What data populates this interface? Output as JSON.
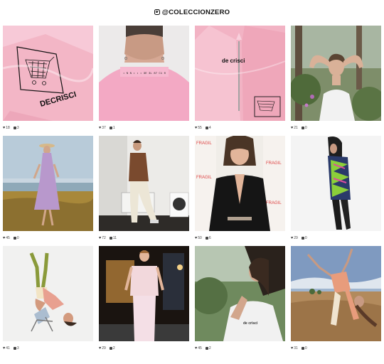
{
  "header": {
    "handle": "@COLECCIONZERO",
    "icon": "instagram-icon"
  },
  "posts": [
    {
      "likes": "18",
      "comments": "3"
    },
    {
      "likes": "37",
      "comments": "1"
    },
    {
      "likes": "55",
      "comments": "4"
    },
    {
      "likes": "21",
      "comments": "0"
    },
    {
      "likes": "45",
      "comments": "0"
    },
    {
      "likes": "72",
      "comments": "11"
    },
    {
      "likes": "50",
      "comments": "6"
    },
    {
      "likes": "29",
      "comments": "0"
    },
    {
      "likes": "41",
      "comments": "3"
    },
    {
      "likes": "29",
      "comments": "2"
    },
    {
      "likes": "45",
      "comments": "2"
    },
    {
      "likes": "31",
      "comments": "0"
    }
  ],
  "image_text": {
    "p1_brand": "DECRISCI",
    "p2_neck": "• N N • • • 3E 3L 87 C1 0",
    "p3_brand": "de crisci",
    "p7_fragil": "FRAGIL",
    "p11_shirt": "de crisci"
  }
}
